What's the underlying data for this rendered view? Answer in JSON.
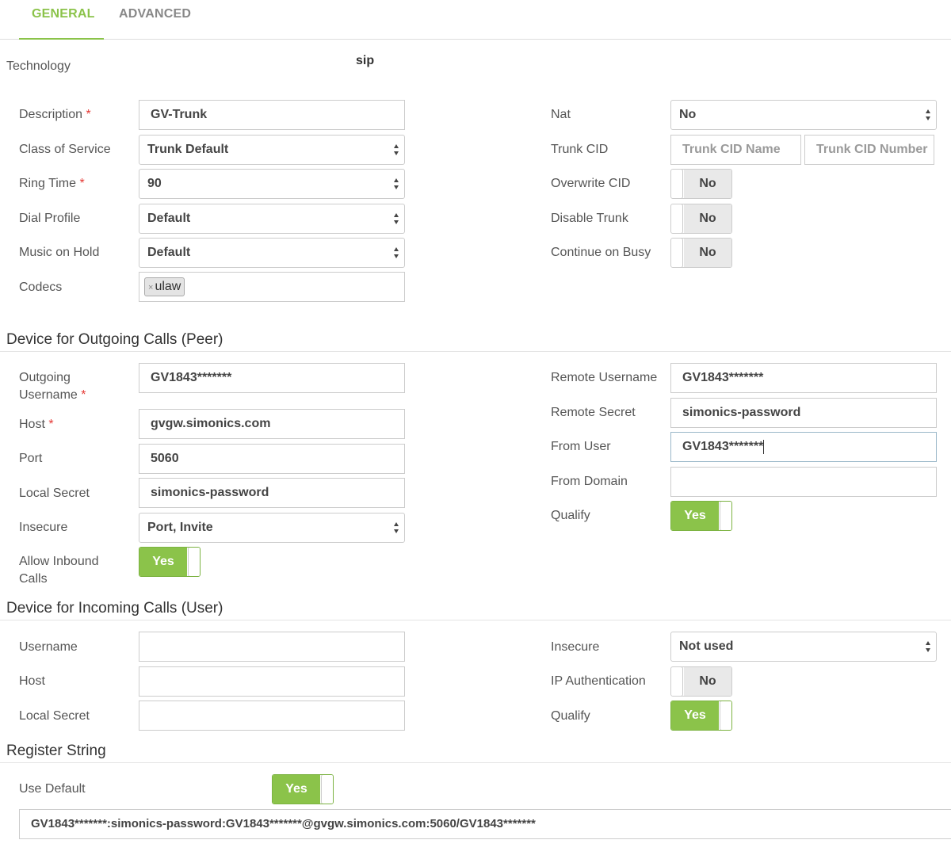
{
  "tabs": {
    "general": "GENERAL",
    "advanced": "ADVANCED"
  },
  "technology": {
    "label": "Technology",
    "value": "sip"
  },
  "general": {
    "description": {
      "label": "Description",
      "value": "GV-Trunk"
    },
    "class_of_service": {
      "label": "Class of Service",
      "value": "Trunk Default"
    },
    "ring_time": {
      "label": "Ring Time",
      "value": "90"
    },
    "dial_profile": {
      "label": "Dial Profile",
      "value": "Default"
    },
    "music_on_hold": {
      "label": "Music on Hold",
      "value": "Default"
    },
    "codecs": {
      "label": "Codecs",
      "tags": [
        "ulaw"
      ],
      "remove_glyph": "×"
    },
    "nat": {
      "label": "Nat",
      "value": "No"
    },
    "trunk_cid": {
      "label": "Trunk CID",
      "name_placeholder": "Trunk CID Name",
      "number_placeholder": "Trunk CID Number"
    },
    "overwrite_cid": {
      "label": "Overwrite CID",
      "value": "No"
    },
    "disable_trunk": {
      "label": "Disable Trunk",
      "value": "No"
    },
    "continue_on_busy": {
      "label": "Continue on Busy",
      "value": "No"
    }
  },
  "peer": {
    "title": "Device for Outgoing Calls (Peer)",
    "outgoing_username": {
      "label_line1": "Outgoing",
      "label_line2": "Username",
      "value": "GV1843*******"
    },
    "host": {
      "label": "Host",
      "value": "gvgw.simonics.com"
    },
    "port": {
      "label": "Port",
      "value": "5060"
    },
    "local_secret": {
      "label": "Local Secret",
      "value": "simonics-password"
    },
    "insecure": {
      "label": "Insecure",
      "value": "Port, Invite"
    },
    "allow_inbound": {
      "label_line1": "Allow Inbound",
      "label_line2": "Calls",
      "value": "Yes"
    },
    "remote_username": {
      "label": "Remote Username",
      "value": "GV1843*******"
    },
    "remote_secret": {
      "label": "Remote Secret",
      "value": "simonics-password"
    },
    "from_user": {
      "label": "From User",
      "value": "GV1843*******"
    },
    "from_domain": {
      "label": "From Domain",
      "value": ""
    },
    "qualify": {
      "label": "Qualify",
      "value": "Yes"
    }
  },
  "user": {
    "title": "Device for Incoming Calls (User)",
    "username": {
      "label": "Username",
      "value": ""
    },
    "host": {
      "label": "Host",
      "value": ""
    },
    "local_secret": {
      "label": "Local Secret",
      "value": ""
    },
    "insecure": {
      "label": "Insecure",
      "value": "Not used"
    },
    "ip_auth": {
      "label": "IP Authentication",
      "value": "No"
    },
    "qualify": {
      "label": "Qualify",
      "value": "Yes"
    }
  },
  "register": {
    "title": "Register String",
    "use_default": {
      "label": "Use Default",
      "value": "Yes"
    },
    "string": "GV1843*******:simonics-password:GV1843*******@gvgw.simonics.com:5060/GV1843*******"
  },
  "required_marker": "*",
  "colors": {
    "accent": "#8bc34a",
    "required": "#e53935"
  }
}
